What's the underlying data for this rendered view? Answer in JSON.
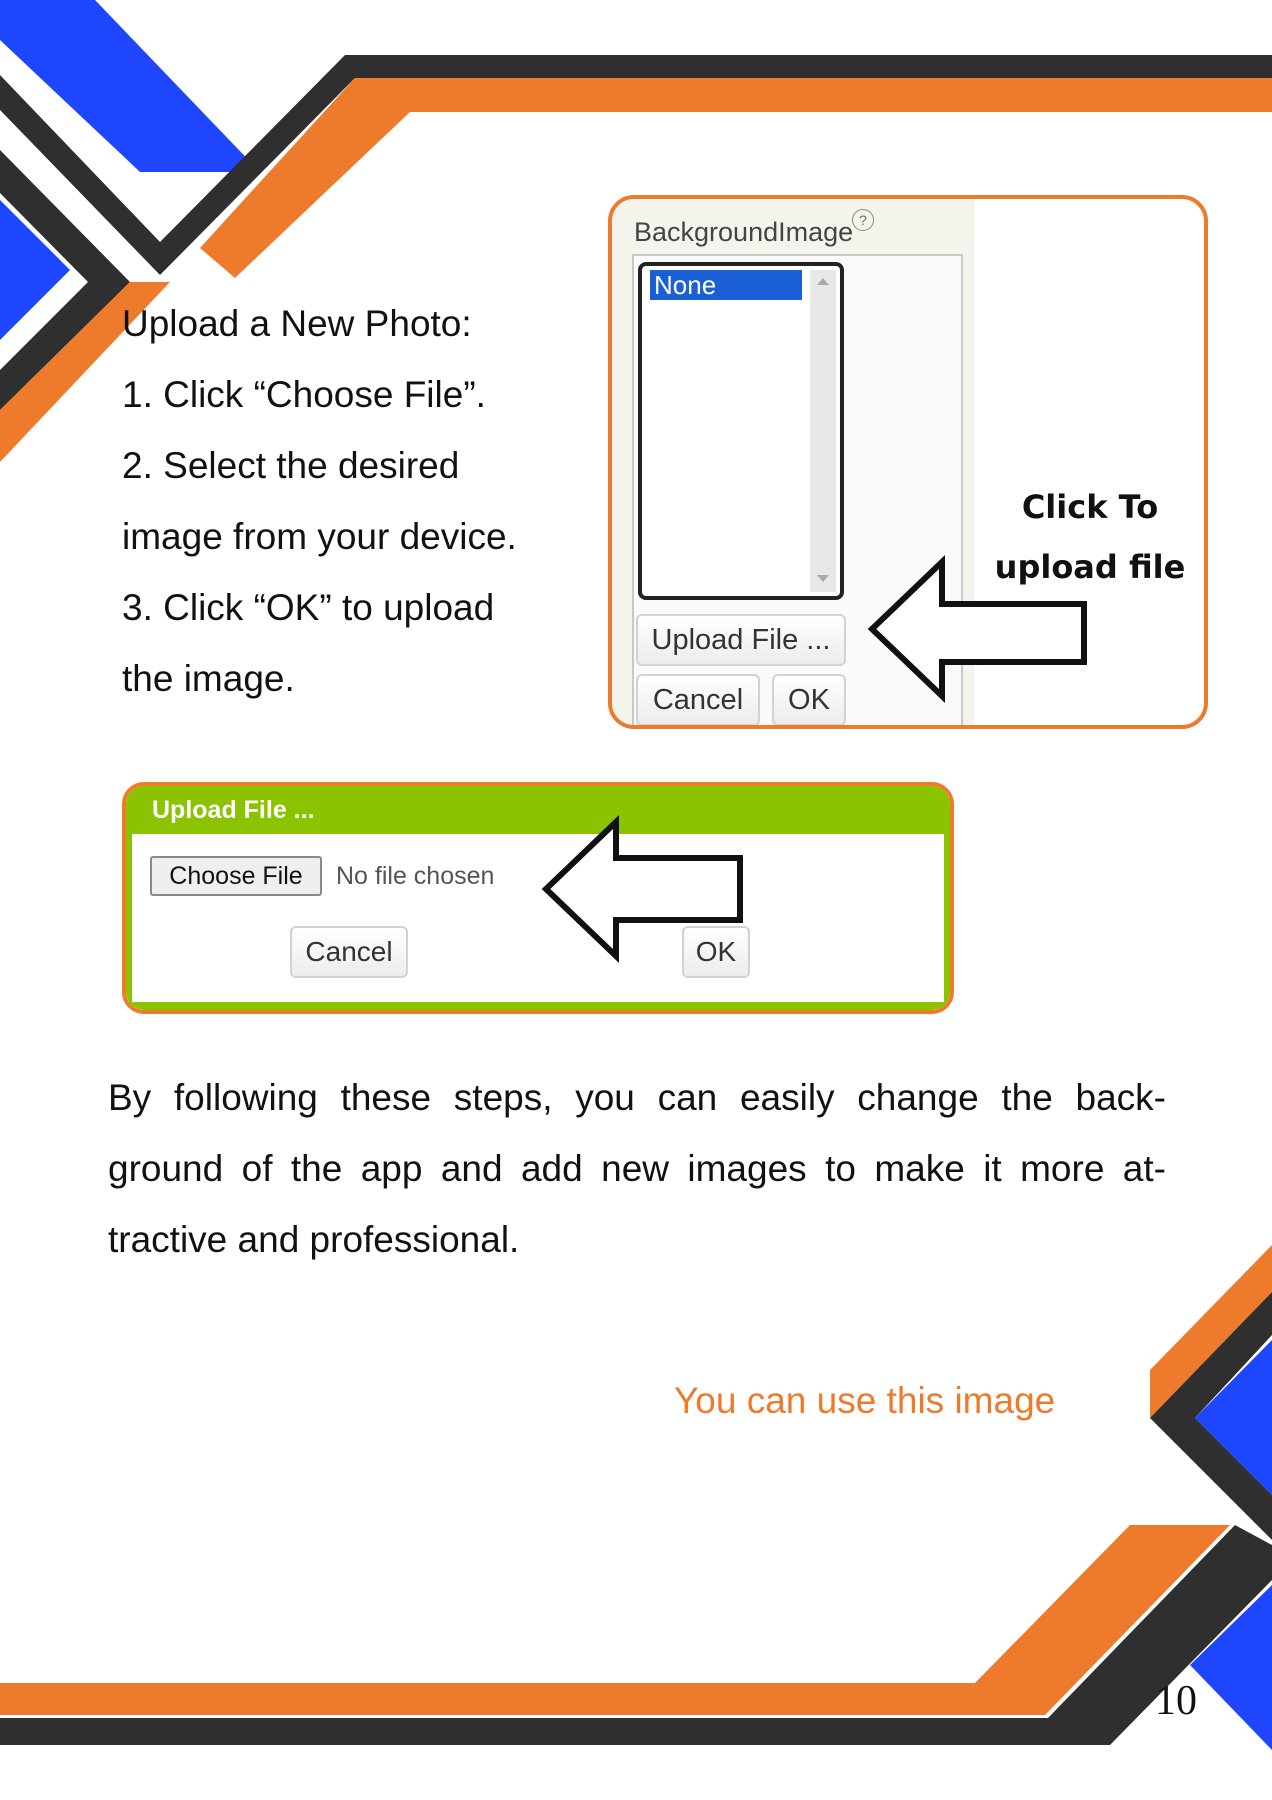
{
  "instructions": {
    "heading": "Upload a New Photo:",
    "step1": "1. Click “Choose File”.",
    "step2_line1": "2. Select the desired",
    "step2_line2": "image from your device.",
    "step3_line1": "3. Click “OK” to upload",
    "step3_line2": "the image."
  },
  "property_panel": {
    "label": "BackgroundImage",
    "help_icon": "?",
    "list_selected": "None",
    "upload_button": "Upload File ...",
    "cancel_button": "Cancel",
    "ok_button": "OK"
  },
  "callout": {
    "line1": "Click To",
    "line2": "upload file"
  },
  "upload_dialog": {
    "title": "Upload File ...",
    "choose_button": "Choose File",
    "status": "No file chosen",
    "cancel_button": "Cancel",
    "ok_button": "OK"
  },
  "summary": "By following these steps, you can easily change the back-ground of the app and add new images to make it more at-tractive and professional.",
  "caption": "You can use this image",
  "page_number": "10",
  "colors": {
    "orange": "#ee7a2c",
    "dark": "#2f2f2f",
    "blue": "#1f46ff",
    "green": "#8bc300",
    "selection_blue": "#1a5fd6"
  }
}
